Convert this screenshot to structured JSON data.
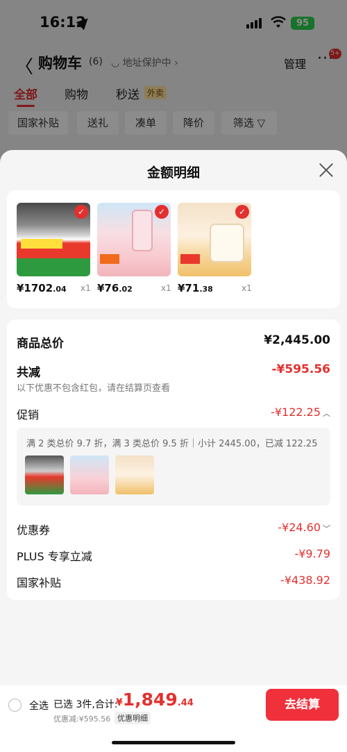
{
  "status": {
    "time": "16:12",
    "battery": "95"
  },
  "nav": {
    "title": "购物车",
    "count": "(6)",
    "address": "地址保护中",
    "manage": "管理",
    "more_badge": "5+"
  },
  "tabs": [
    {
      "label": "全部"
    },
    {
      "label": "购物"
    },
    {
      "label": "秒送"
    }
  ],
  "takeout_badge": "外卖",
  "filters": [
    {
      "label": "国家补贴"
    },
    {
      "label": "送礼"
    },
    {
      "label": "凑单"
    },
    {
      "label": "降价"
    },
    {
      "label": "筛选"
    }
  ],
  "sheet": {
    "title": "金额明细",
    "products": [
      {
        "price_int": "¥1702",
        "price_dec": ".04",
        "qty": "x1"
      },
      {
        "price_int": "¥76",
        "price_dec": ".02",
        "qty": "x1"
      },
      {
        "price_int": "¥71",
        "price_dec": ".38",
        "qty": "x1"
      }
    ],
    "goods_total_label": "商品总价",
    "goods_total_value": "¥2,445.00",
    "reduce_label": "共减",
    "reduce_value": "-¥595.56",
    "reduce_note": "以下优惠不包含红包，请在结算页查看",
    "promo_label": "促销",
    "promo_value": "-¥122.25",
    "promo_text": "满 2 类总价 9.7 折，满 3 类总价 9.5 折｜小计 2445.00，已减 122.25",
    "coupon_label": "优惠券",
    "coupon_value": "-¥24.60",
    "plus_label": "PLUS 专享立减",
    "plus_value": "-¥9.79",
    "subsidy_label": "国家补贴",
    "subsidy_value": "-¥438.92"
  },
  "bottom": {
    "select_all": "全选",
    "selected": "已选 3件,合计:",
    "total_currency": "¥",
    "total_int": "1,849",
    "total_dec": ".44",
    "discount_sub": "优惠减:¥595.56",
    "detail_link": "优惠明细",
    "checkout": "去结算"
  }
}
